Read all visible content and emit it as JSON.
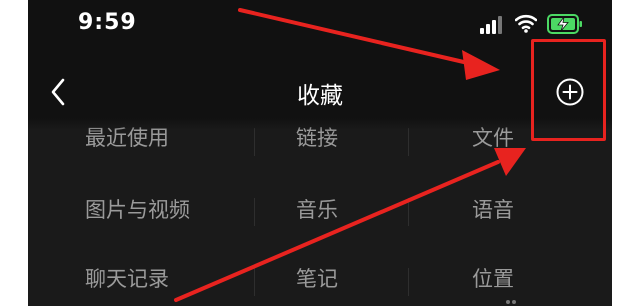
{
  "status_bar": {
    "time": "9:59",
    "icons": [
      "cellular-signal-icon",
      "wifi-icon",
      "battery-charging-icon"
    ],
    "battery_color": "#4cd964"
  },
  "nav": {
    "back_icon": "chevron-left-icon",
    "title": "收藏",
    "add_icon": "plus-circle-icon"
  },
  "categories": [
    {
      "label": "最近使用"
    },
    {
      "label": "链接"
    },
    {
      "label": "文件"
    },
    {
      "label": "图片与视频"
    },
    {
      "label": "音乐"
    },
    {
      "label": "语音"
    },
    {
      "label": "聊天记录"
    },
    {
      "label": "笔记"
    },
    {
      "label": "位置"
    }
  ],
  "annotation": {
    "color": "#e8231f",
    "target": "add-button"
  }
}
